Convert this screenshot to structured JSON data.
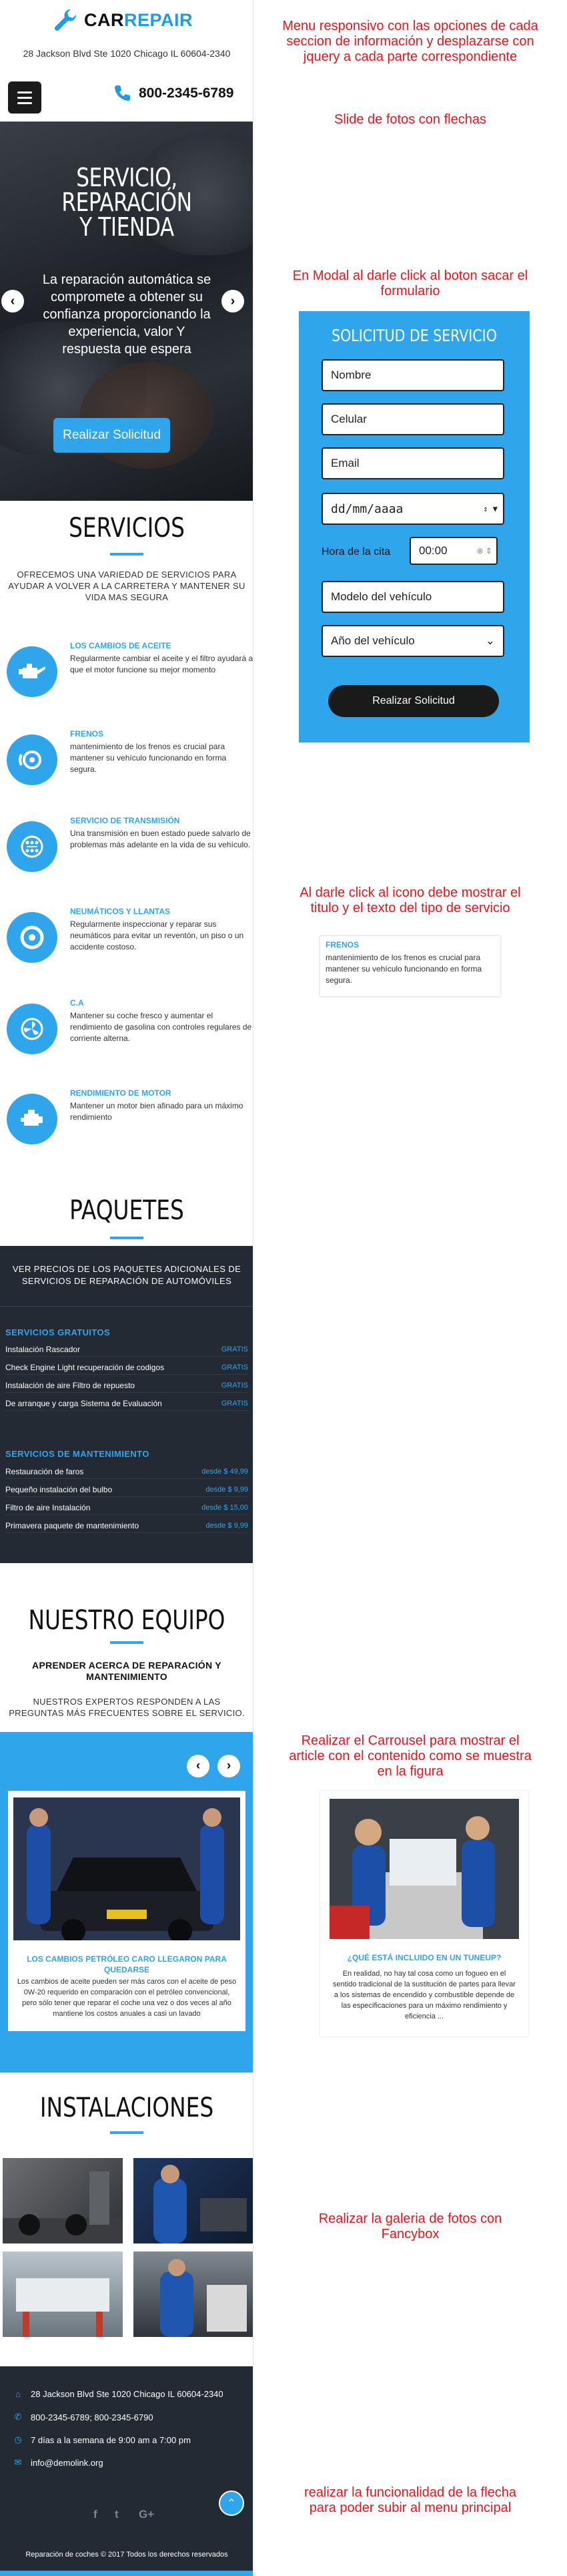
{
  "header": {
    "logo_part1": "CAR",
    "logo_part2": "REPAIR",
    "address": "28 Jackson Blvd Ste 1020 Chicago IL 60604-2340",
    "phone": "800-2345-6789",
    "brand_color": "#1e9be9"
  },
  "hero": {
    "title": "SERVICIO,\nREPARACIÓN\nY TIENDA",
    "text": "La reparación automática se compromete a obtener su confianza proporcionando la experiencia, valor Y respuesta que espera",
    "button": "Realizar Solicitud",
    "prev_icon": "chevron-left-icon",
    "next_icon": "chevron-right-icon"
  },
  "services": {
    "title": "SERVICIOS",
    "subtitle": "OFRECEMOS UNA VARIEDAD DE SERVICIOS PARA AYUDAR A VOLVER A LA CARRETERA Y MANTENER SU VIDA MAS SEGURA",
    "items": [
      {
        "title": "LOS CAMBIOS DE ACEITE",
        "text": "Regularmente cambiar el aceite y el filtro ayudará a que el motor funcione su mejor momento",
        "icon": "oil-can-icon"
      },
      {
        "title": "FRENOS",
        "text": "mantenimiento de los frenos es crucial para mantener su vehículo funcionando en forma segura.",
        "icon": "brake-icon"
      },
      {
        "title": "SERVICIO DE TRANSMISIÓN",
        "text": "Una transmisión en buen estado puede salvarlo de problemas más adelante en la vida de su vehículo.",
        "icon": "transmission-icon"
      },
      {
        "title": "NEUMÁTICOS Y LLANTAS",
        "text": "Regularmente inspeccionar y reparar sus neumáticos para evitar un reventón, un piso o un accidente costoso.",
        "icon": "tire-icon"
      },
      {
        "title": "C.A",
        "text": "Mantener su coche fresco y aumentar el rendimiento de gasolina con controles regulares de corriente alterna.",
        "icon": "fan-icon"
      },
      {
        "title": "RENDIMIENTO DE MOTOR",
        "text": "Mantener un motor bien afinado para un máximo rendimiento",
        "icon": "engine-icon"
      }
    ]
  },
  "packages": {
    "title": "PAQUETES",
    "intro": "VER PRECIOS DE LOS PAQUETES ADICIONALES DE SERVICIOS DE REPARACIÓN DE AUTOMÓVILES",
    "free_heading": "SERVICIOS GRATUITOS",
    "free_items": [
      {
        "name": "Instalación Rascador",
        "price": "GRATIS"
      },
      {
        "name": "Check Engine Light recuperación de codigos",
        "price": "GRATIS"
      },
      {
        "name": "Instalación de aire Filtro de repuesto",
        "price": "GRATIS"
      },
      {
        "name": "De arranque y carga Sistema de Evaluación",
        "price": "GRATIS"
      }
    ],
    "maint_heading": "SERVICIOS DE MANTENIMIENTO",
    "maint_items": [
      {
        "name": "Restauración de faros",
        "price": "desde $ 49,99"
      },
      {
        "name": "Pequeño instalación del bulbo",
        "price": "desde $ 9,99"
      },
      {
        "name": "Filtro de aire Instalación",
        "price": "desde $ 15,00"
      },
      {
        "name": "Primavera paquete de mantenimiento",
        "price": "desde $ 9,99"
      }
    ]
  },
  "team": {
    "title": "NUESTRO EQUIPO",
    "subtitle": "APRENDER ACERCA DE REPARACIÓN Y MANTENIMIENTO",
    "text": "NUESTROS EXPERTOS RESPONDEN A LAS PREGUNTAS MÁS FRECUENTES SOBRE EL SERVICIO.",
    "card1_title": "LOS CAMBIOS PETRÓLEO CARO LLEGARON PARA QUEDARSE",
    "card1_text": "Los cambios de aceite pueden ser más caros con el aceite de peso 0W-20 requerido en comparación con el petróleo convencional, pero sólo tener que reparar el coche una vez o dos veces al año mantiene los costos anuales a casi un lavado",
    "card2_title": "¿QUÉ ESTÁ INCLUIDO EN UN TUNEUP?",
    "card2_text": "En realidad, no hay tal cosa como un fogueo en el sentido tradicional de la sustitución de partes para llevar a los sistemas de encendido y combustible depende de las especificaciones para un máximo rendimiento y eficiencia ..."
  },
  "installations": {
    "title": "INSTALACIONES"
  },
  "footer": {
    "address": "28 Jackson Blvd Ste 1020 Chicago IL 60604-2340",
    "phones": "800-2345-6789; 800-2345-6790",
    "hours": "7 días a la semana de 9:00 am a 7:00 pm",
    "email": "info@demolink.org",
    "social": [
      "f",
      "t",
      "G+"
    ],
    "copyright": "Reparación de coches © 2017 Todos los derechos reservados"
  },
  "modal": {
    "title": "SOLICITUD DE SERVICIO",
    "name_placeholder": "Nombre",
    "cell_placeholder": "Celular",
    "email_placeholder": "Email",
    "date_value": "dd/mm/aaaa",
    "time_label": "Hora de la cita",
    "time_value": "00:00",
    "model_placeholder": "Modelo del vehículo",
    "year_value": "Año del vehículo",
    "submit": "Realizar Solicitud"
  },
  "popup": {
    "title": "FRENOS",
    "text": "mantenimiento de los frenos es crucial para mantener su vehículo funcionando en forma segura."
  },
  "notes": {
    "n1": "Menu responsivo con las opciones de cada seccion de información y desplazarse con jquery a cada parte correspondiente",
    "n2": "Slide de fotos con flechas",
    "n3": "En Modal al darle click al boton sacar el formulario",
    "n4": "Al darle click al icono debe mostrar el titulo y el texto del tipo de servicio",
    "n5": "Realizar el Carrousel para mostrar el article con el contenido como se muestra en la figura",
    "n6": "Realizar la galeria de fotos con Fancybox",
    "n7": "realizar la funcionalidad de la flecha para poder subir al menu principal"
  }
}
